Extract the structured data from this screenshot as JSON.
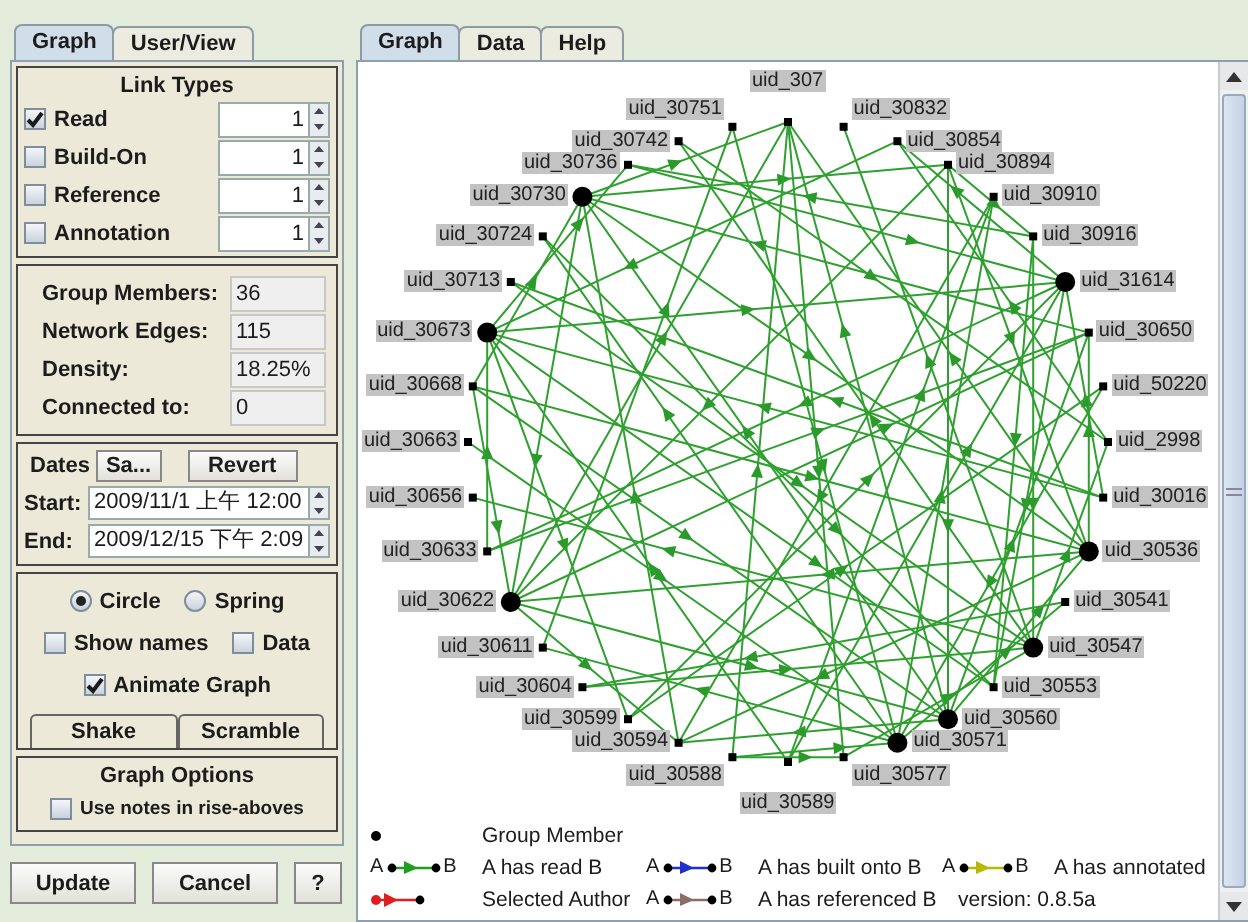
{
  "left_tabs": [
    {
      "label": "Graph",
      "selected": true
    },
    {
      "label": "User/View",
      "selected": false
    }
  ],
  "link_types": {
    "title": "Link Types",
    "items": [
      {
        "label": "Read",
        "checked": true,
        "value": "1"
      },
      {
        "label": "Build-On",
        "checked": false,
        "value": "1"
      },
      {
        "label": "Reference",
        "checked": false,
        "value": "1"
      },
      {
        "label": "Annotation",
        "checked": false,
        "value": "1"
      }
    ]
  },
  "stats": [
    {
      "label": "Group Members:",
      "value": "36"
    },
    {
      "label": "Network Edges:",
      "value": "115"
    },
    {
      "label": "Density:",
      "value": "18.25%"
    },
    {
      "label": "Connected to:",
      "value": "0"
    }
  ],
  "dates": {
    "label": "Dates",
    "buttons": [
      "Sa...",
      "Revert"
    ],
    "fields": [
      {
        "label": "Start:",
        "value": "2009/11/1 上午 12:00"
      },
      {
        "label": "End:",
        "value": "2009/12/15 下午 2:09"
      }
    ]
  },
  "layout": {
    "options": [
      {
        "label": "Circle",
        "selected": true
      },
      {
        "label": "Spring",
        "selected": false
      }
    ],
    "toggle_rows": [
      [
        {
          "label": "Show names",
          "checked": false
        },
        {
          "label": "Data",
          "checked": false
        }
      ],
      [
        {
          "label": "Animate Graph",
          "checked": true
        }
      ]
    ],
    "buttons": [
      "Shake",
      "Scramble"
    ]
  },
  "graph_options": {
    "title": "Graph Options",
    "toggles": [
      {
        "label": "Use notes in rise-aboves",
        "checked": false
      }
    ]
  },
  "footer_buttons": [
    "Update",
    "Cancel",
    "?"
  ],
  "main_tabs": [
    {
      "label": "Graph",
      "selected": true
    },
    {
      "label": "Data",
      "selected": false
    },
    {
      "label": "Help",
      "selected": false
    }
  ],
  "graph": {
    "node_groups": [
      {
        "kind": "top",
        "nodes": [
          {
            "label": "uid_307",
            "kind": "member"
          }
        ]
      },
      {
        "kind": "left",
        "nodes": [
          {
            "label": "uid_30751",
            "kind": "member"
          },
          {
            "label": "uid_30742",
            "kind": "member"
          },
          {
            "label": "uid_30736",
            "kind": "member"
          },
          {
            "label": "uid_30730",
            "kind": "hub"
          },
          {
            "label": "uid_30724",
            "kind": "member"
          },
          {
            "label": "uid_30713",
            "kind": "member"
          },
          {
            "label": "uid_30673",
            "kind": "hub"
          },
          {
            "label": "uid_30668",
            "kind": "member"
          },
          {
            "label": "uid_30663",
            "kind": "member"
          },
          {
            "label": "uid_30656",
            "kind": "member"
          },
          {
            "label": "uid_30633",
            "kind": "member"
          },
          {
            "label": "uid_30622",
            "kind": "hub"
          },
          {
            "label": "uid_30611",
            "kind": "member"
          },
          {
            "label": "uid_30604",
            "kind": "member"
          },
          {
            "label": "uid_30599",
            "kind": "member"
          },
          {
            "label": "uid_30594",
            "kind": "member"
          },
          {
            "label": "uid_30588",
            "kind": "member"
          }
        ]
      },
      {
        "kind": "right",
        "nodes": [
          {
            "label": "uid_30832",
            "kind": "member"
          },
          {
            "label": "uid_30854",
            "kind": "member"
          },
          {
            "label": "uid_30894",
            "kind": "member"
          },
          {
            "label": "uid_30910",
            "kind": "member"
          },
          {
            "label": "uid_30916",
            "kind": "member"
          },
          {
            "label": "uid_31614",
            "kind": "hub"
          },
          {
            "label": "uid_30650",
            "kind": "member"
          },
          {
            "label": "uid_50220",
            "kind": "member"
          },
          {
            "label": "uid_2998",
            "kind": "member"
          },
          {
            "label": "uid_30016",
            "kind": "member"
          },
          {
            "label": "uid_30536",
            "kind": "hub"
          },
          {
            "label": "uid_30541",
            "kind": "member"
          },
          {
            "label": "uid_30547",
            "kind": "hub"
          },
          {
            "label": "uid_30553",
            "kind": "member"
          },
          {
            "label": "uid_30560",
            "kind": "hub"
          },
          {
            "label": "uid_30571",
            "kind": "hub"
          },
          {
            "label": "uid_30577",
            "kind": "member"
          }
        ]
      },
      {
        "kind": "bottom",
        "nodes": [
          {
            "label": "uid_30589",
            "kind": "member"
          }
        ]
      }
    ],
    "legend_rows": [
      [
        {
          "kind": "member",
          "label": "Group Member"
        }
      ],
      [
        {
          "kind": "link",
          "from": "A",
          "to": "B",
          "color": "#1f9e1f",
          "label": "A has read B"
        },
        {
          "kind": "link",
          "from": "A",
          "to": "B",
          "color": "#1f2fd0",
          "label": "A has built onto B"
        },
        {
          "kind": "link",
          "from": "A",
          "to": "B",
          "color": "#b8b800",
          "label": "A has annotated"
        }
      ],
      [
        {
          "kind": "author",
          "color": "#dd1f1f",
          "label": "Selected Author"
        },
        {
          "kind": "link",
          "from": "A",
          "to": "B",
          "color": "#8a6e64",
          "label": "A has referenced B"
        }
      ]
    ],
    "version": "version: 0.8.5a"
  }
}
